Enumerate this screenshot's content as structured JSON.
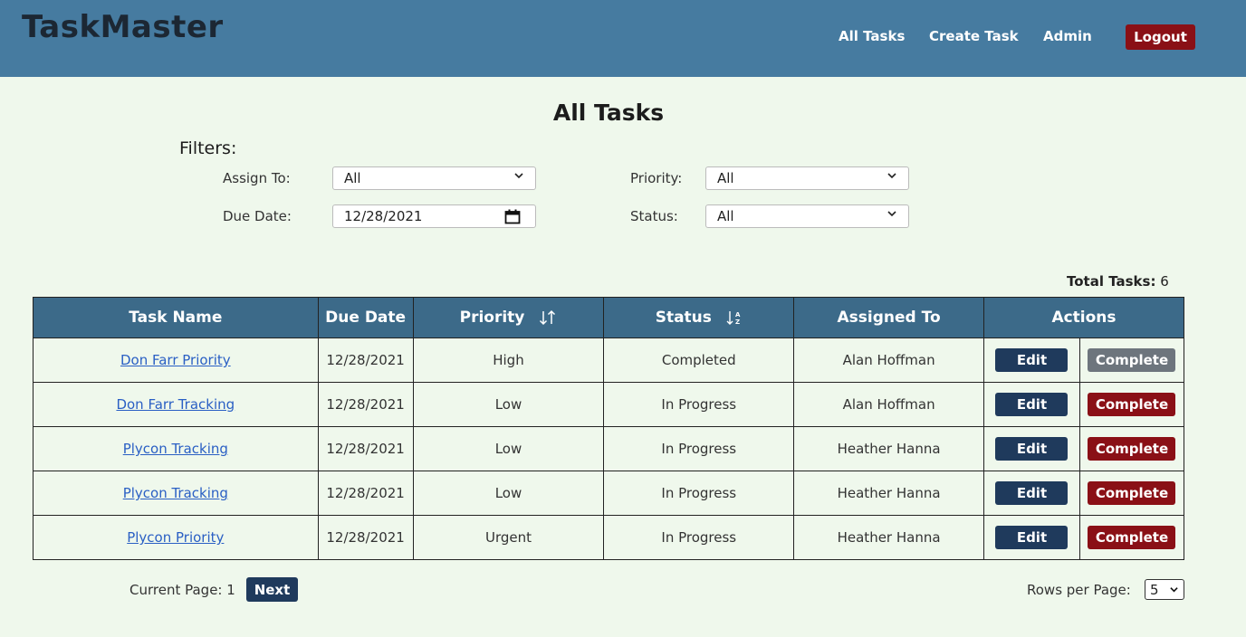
{
  "header": {
    "brand": "TaskMaster",
    "nav": {
      "all_tasks": "All Tasks",
      "create_task": "Create Task",
      "admin": "Admin",
      "logout": "Logout"
    },
    "colors": {
      "bar": "#467ba0",
      "logout": "#8a1016"
    }
  },
  "main": {
    "title": "All Tasks",
    "filters_label": "Filters:",
    "filters": {
      "assign_to": {
        "label": "Assign To:",
        "value": "All"
      },
      "due_date": {
        "label": "Due Date:",
        "value": "12/28/2021"
      },
      "priority": {
        "label": "Priority:",
        "value": "All"
      },
      "status": {
        "label": "Status:",
        "value": "All"
      }
    },
    "total_label": "Total Tasks:",
    "total_value": "6"
  },
  "table": {
    "columns": [
      "Task Name",
      "Due Date",
      "Priority",
      "Status",
      "Assigned To",
      "Actions"
    ],
    "rows": [
      {
        "name": "Don Farr Priority",
        "due": "12/28/2021",
        "priority": "High",
        "status": "Completed",
        "assigned": "Alan Hoffman",
        "edit": "Edit",
        "complete": "Complete",
        "complete_disabled": true
      },
      {
        "name": "Don Farr Tracking",
        "due": "12/28/2021",
        "priority": "Low",
        "status": "In Progress",
        "assigned": "Alan Hoffman",
        "edit": "Edit",
        "complete": "Complete",
        "complete_disabled": false
      },
      {
        "name": "Plycon Tracking",
        "due": "12/28/2021",
        "priority": "Low",
        "status": "In Progress",
        "assigned": "Heather Hanna",
        "edit": "Edit",
        "complete": "Complete",
        "complete_disabled": false
      },
      {
        "name": "Plycon Tracking",
        "due": "12/28/2021",
        "priority": "Low",
        "status": "In Progress",
        "assigned": "Heather Hanna",
        "edit": "Edit",
        "complete": "Complete",
        "complete_disabled": false
      },
      {
        "name": "Plycon Priority",
        "due": "12/28/2021",
        "priority": "Urgent",
        "status": "In Progress",
        "assigned": "Heather Hanna",
        "edit": "Edit",
        "complete": "Complete",
        "complete_disabled": false
      }
    ]
  },
  "pagination": {
    "current_page_label": "Current Page: 1",
    "next": "Next",
    "rows_per_page_label": "Rows per Page:",
    "rows_per_page_value": "5"
  }
}
